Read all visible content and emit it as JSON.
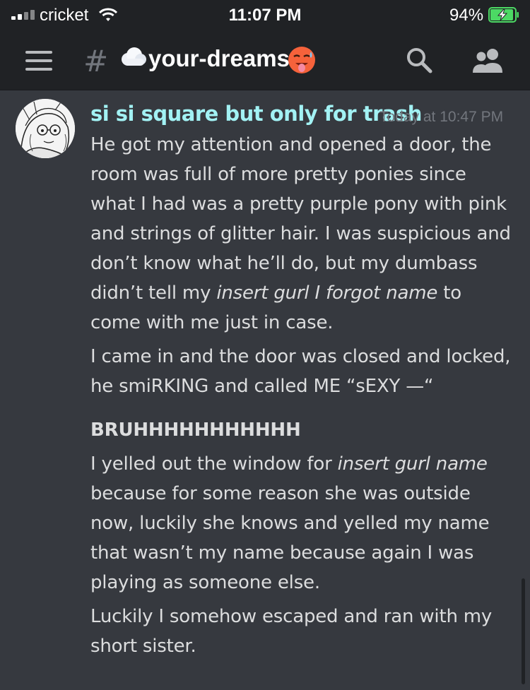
{
  "status_bar": {
    "carrier": "cricket",
    "time": "11:07 PM",
    "battery_percent": "94%",
    "battery_level": 0.94,
    "signal_icon": "signal-bars-icon",
    "wifi_icon": "wifi-icon",
    "battery_icon": "battery-charging-icon"
  },
  "header": {
    "hash": "#",
    "channel_name": "your-dreams",
    "channel_prefix_emoji": "cloud-emoji",
    "channel_suffix_emoji": "hot-face-emoji",
    "menu_icon": "hamburger-menu-icon",
    "search_icon": "search-icon",
    "members_icon": "members-icon"
  },
  "message": {
    "author": "si si square but only for trash",
    "timestamp": "Today at 10:47 PM",
    "author_color": "#a2f2f4",
    "paragraphs": [
      {
        "pre": "He got my attention and opened a door, the room was full of more pretty ponies since what I had was a pretty purple pony with pink and strings of glitter hair. I was suspicious and don’t know what he’ll do, but my dumbass didn’t tell my ",
        "italic": "insert gurl I forgot name",
        "post": " to come with me just in case."
      },
      {
        "text": "I came in and the door was closed and locked, he smiRKING and called ME “sEXY —“"
      },
      {
        "text": "BRUHHHHHHHHHHH"
      },
      {
        "pre": "I yelled out the window for ",
        "italic": "insert  gurl name",
        "post": " because for some reason she was outside now, luckily she knows and yelled my name that wasn’t my name because again I was playing as someone else."
      },
      {
        "text": "Luckily I somehow escaped and ran with my short sister."
      }
    ]
  },
  "colors": {
    "background": "#36393f",
    "header": "#202225",
    "text": "#dcddde",
    "muted": "#72767d"
  }
}
